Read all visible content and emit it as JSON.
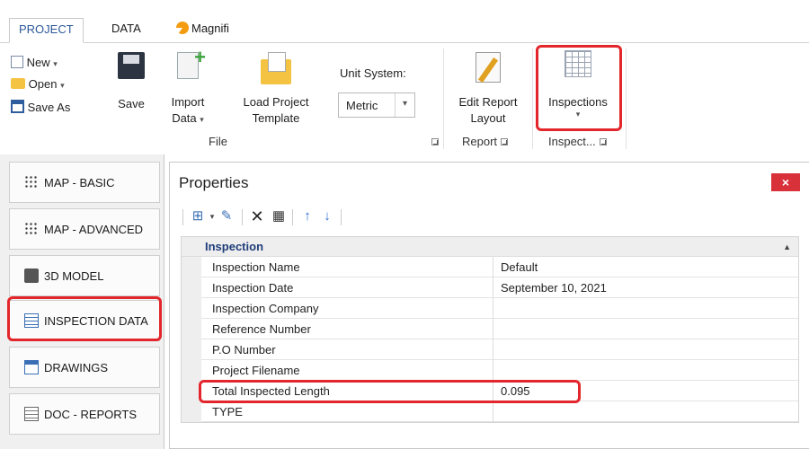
{
  "ribbon": {
    "tabs": [
      {
        "label": "PROJECT",
        "active": true
      },
      {
        "label": "DATA",
        "active": false
      },
      {
        "label": "Magnifi",
        "active": false
      }
    ],
    "file_group": {
      "new_label": "New",
      "open_label": "Open",
      "save_as_label": "Save As",
      "save_label": "Save",
      "import_label_1": "Import",
      "import_label_2": "Data",
      "load_template_1": "Load Project",
      "load_template_2": "Template",
      "unit_system_label": "Unit System:",
      "unit_system_value": "Metric",
      "group_label": "File"
    },
    "report_group": {
      "edit_layout_1": "Edit Report",
      "edit_layout_2": "Layout",
      "group_label": "Report"
    },
    "inspect_group": {
      "inspections_label": "Inspections",
      "group_label": "Inspect..."
    }
  },
  "nav": {
    "items": [
      {
        "label": "MAP - BASIC",
        "icon": "dots-icon"
      },
      {
        "label": "MAP - ADVANCED",
        "icon": "dots-icon"
      },
      {
        "label": "3D MODEL",
        "icon": "cube-icon"
      },
      {
        "label": "INSPECTION DATA",
        "icon": "list-icon"
      },
      {
        "label": "DRAWINGS",
        "icon": "drawing-icon"
      },
      {
        "label": "DOC - REPORTS",
        "icon": "docrep-icon"
      }
    ]
  },
  "properties": {
    "title": "Properties",
    "close_glyph": "×",
    "category": "Inspection",
    "rows": [
      {
        "name": "Inspection Name",
        "value": "Default"
      },
      {
        "name": "Inspection Date",
        "value": "September 10, 2021"
      },
      {
        "name": "Inspection Company",
        "value": ""
      },
      {
        "name": "Reference Number",
        "value": ""
      },
      {
        "name": "P.O Number",
        "value": ""
      },
      {
        "name": "Project Filename",
        "value": ""
      },
      {
        "name": "Total Inspected Length",
        "value": "0.095"
      },
      {
        "name": "TYPE",
        "value": ""
      }
    ]
  },
  "colors": {
    "highlight": "#e3262b",
    "accent": "#2b579a",
    "close": "#d9313a"
  }
}
